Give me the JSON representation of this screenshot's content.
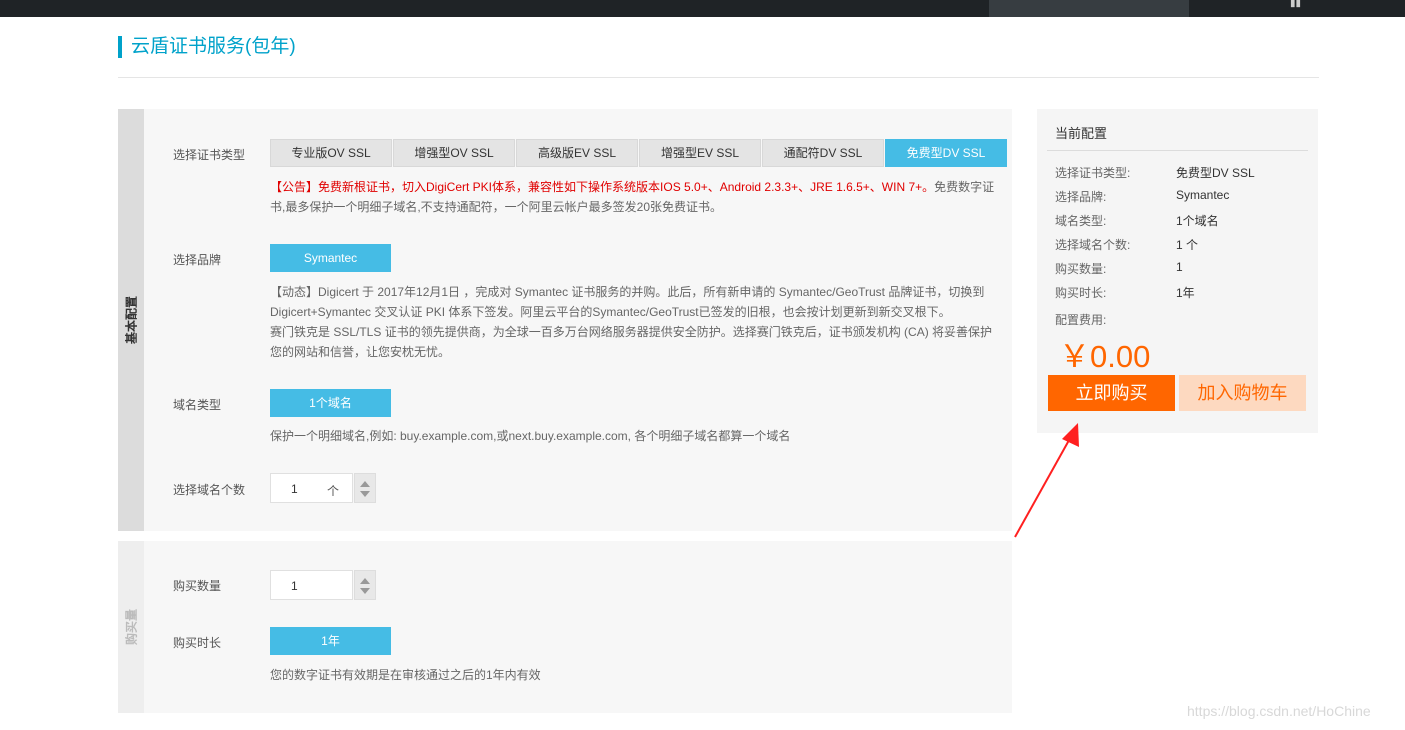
{
  "topbar": {
    "icon": "menu-icon"
  },
  "page": {
    "title": "云盾证书服务(包年)"
  },
  "basic_section": {
    "side_label": "基本配置",
    "cert_type": {
      "label": "选择证书类型",
      "options": [
        "专业版OV SSL",
        "增强型OV SSL",
        "高级版EV SSL",
        "增强型EV SSL",
        "通配符DV SSL",
        "免费型DV SSL"
      ],
      "selected": "免费型DV SSL",
      "notice_red": "【公告】免费新根证书，切入DigiCert PKI体系，兼容性如下操作系统版本IOS 5.0+、Android 2.3.3+、JRE 1.6.5+、WIN 7+。",
      "notice_rest": "免费数字证书,最多保护一个明细子域名,不支持通配符，一个阿里云帐户最多签发20张免费证书。"
    },
    "brand": {
      "label": "选择品牌",
      "selected": "Symantec",
      "description_line1": "【动态】Digicert 于 2017年12月1日 ，完成对 Symantec 证书服务的并购。此后，所有新申请的 Symantec/GeoTrust 品牌证书，切换到 Digicert+Symantec 交叉认证 PKI 体系下签发。阿里云平台的Symantec/GeoTrust已签发的旧根，也会按计划更新到新交叉根下。",
      "description_line2": "赛门铁克是 SSL/TLS 证书的领先提供商，为全球一百多万台网络服务器提供安全防护。选择赛门铁克后，证书颁发机构 (CA) 将妥善保护您的网站和信誉，让您安枕无忧。"
    },
    "domain_type": {
      "label": "域名类型",
      "selected": "1个域名",
      "hint": "保护一个明细域名,例如: buy.example.com,或next.buy.example.com, 各个明细子域名都算一个域名"
    },
    "domain_count": {
      "label": "选择域名个数",
      "value": "1",
      "unit": "个"
    }
  },
  "duration_section": {
    "side_label": "购买量",
    "quantity": {
      "label": "购买数量",
      "value": "1"
    },
    "duration": {
      "label": "购买时长",
      "selected": "1年",
      "hint": "您的数字证书有效期是在审核通过之后的1年内有效"
    }
  },
  "config": {
    "title": "当前配置",
    "rows": [
      {
        "key": "选择证书类型:",
        "value": "免费型DV SSL"
      },
      {
        "key": "选择品牌:",
        "value": "Symantec"
      },
      {
        "key": "域名类型:",
        "value": "1个域名"
      },
      {
        "key": "选择域名个数:",
        "value": "1 个"
      },
      {
        "key": "购买数量:",
        "value": "1"
      },
      {
        "key": "购买时长:",
        "value": "1年"
      }
    ],
    "fee_label": "配置费用:",
    "price": "￥0.00",
    "buy_now": "立即购买",
    "add_cart": "加入购物车"
  },
  "watermark": "https://blog.csdn.net/HoChine",
  "colors": {
    "accent": "#45bce5",
    "title": "#00a2ca",
    "orange": "#ff6600",
    "notice": "#e00000",
    "annotation_arrow": "#ff2020"
  }
}
